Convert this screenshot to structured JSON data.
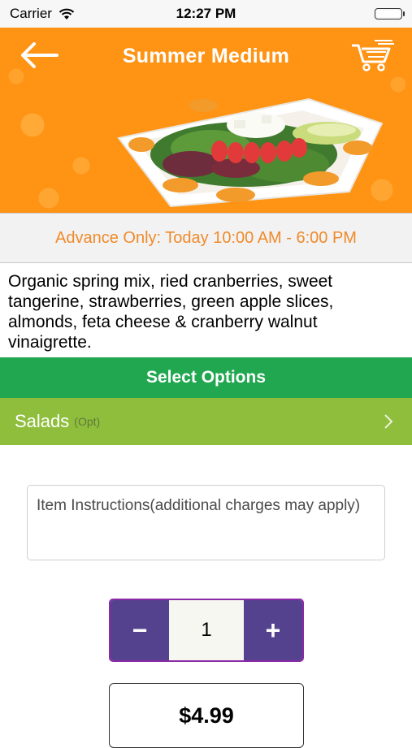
{
  "status_bar": {
    "carrier": "Carrier",
    "time": "12:27 PM"
  },
  "header": {
    "title": "Summer Medium"
  },
  "availability": {
    "text": "Advance Only: Today 10:00 AM - 6:00 PM"
  },
  "description": "Organic spring mix, ried cranberries, sweet tangerine, strawberries, green apple slices, almonds, feta cheese & cranberry walnut vinaigrette.",
  "options": {
    "header": "Select Options",
    "salads_label": "Salads",
    "salads_tag": "(Opt)"
  },
  "instructions": {
    "placeholder": "Item Instructions(additional charges may apply)"
  },
  "quantity": {
    "minus": "−",
    "value": "1",
    "plus": "+"
  },
  "price": "$4.99",
  "colors": {
    "header_orange": "#ff9313",
    "availability_text": "#f08a2a",
    "select_green": "#21a750",
    "salads_green": "#8fbe3d",
    "stepper_purple": "#55428f"
  }
}
